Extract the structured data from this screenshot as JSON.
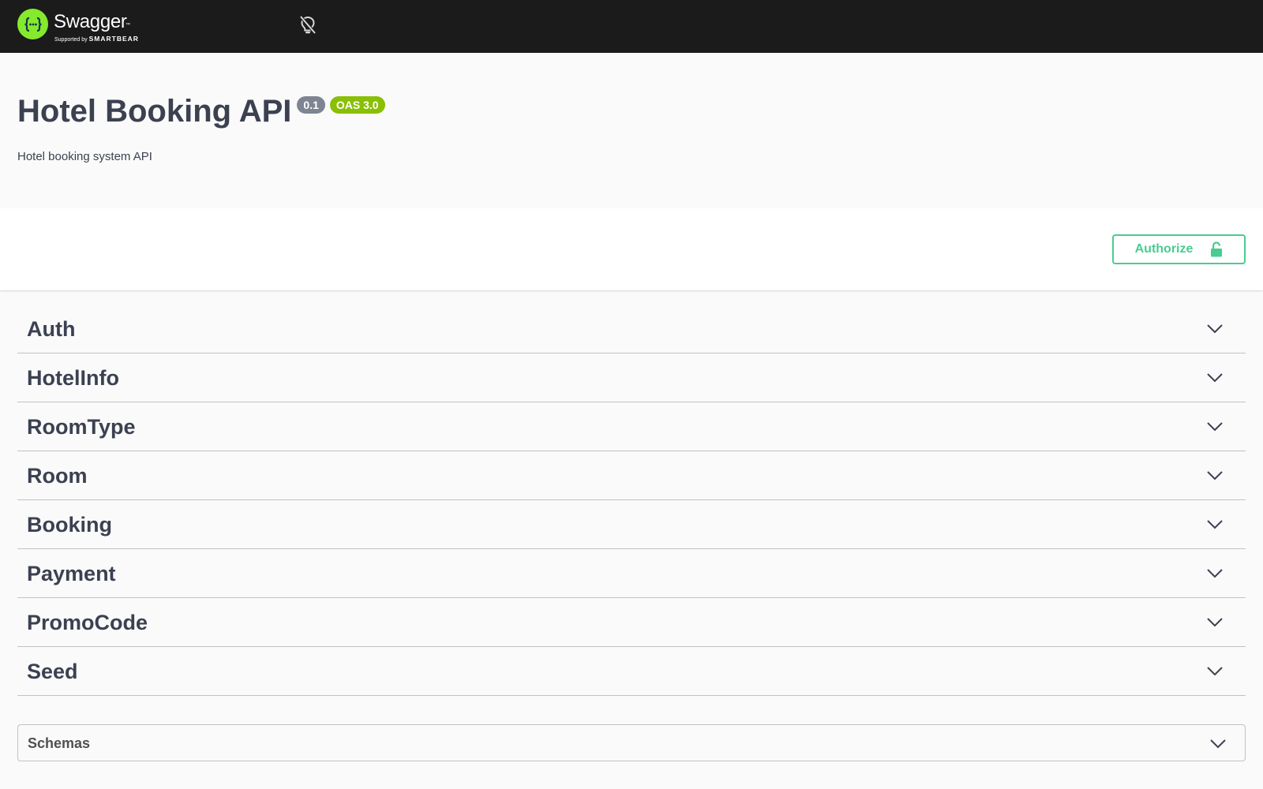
{
  "topbar": {
    "logo_name": "Swagger",
    "logo_trademark": "™",
    "logo_supported_by": "Supported by",
    "logo_company": "SMARTBEAR",
    "logo_icon": "swagger-logo-icon",
    "theme_toggle_icon": "lightbulb-off-icon"
  },
  "info": {
    "title": "Hotel Booking API",
    "version_badge": "0.1",
    "oas_badge": "OAS 3.0",
    "description": "Hotel booking system API"
  },
  "scheme": {
    "authorize_label": "Authorize",
    "authorize_icon": "unlocked-padlock-icon"
  },
  "tags": [
    {
      "label": "Auth"
    },
    {
      "label": "HotelInfo"
    },
    {
      "label": "RoomType"
    },
    {
      "label": "Room"
    },
    {
      "label": "Booking"
    },
    {
      "label": "Payment"
    },
    {
      "label": "PromoCode"
    },
    {
      "label": "Seed"
    }
  ],
  "schemas": {
    "label": "Schemas"
  },
  "colors": {
    "topbar_bg": "#1b1b1b",
    "logo_green": "#85ea2d",
    "authorize_green": "#49cc90",
    "version_badge": "#7d8492",
    "oas_badge": "#89bf04",
    "text": "#3b4151"
  }
}
